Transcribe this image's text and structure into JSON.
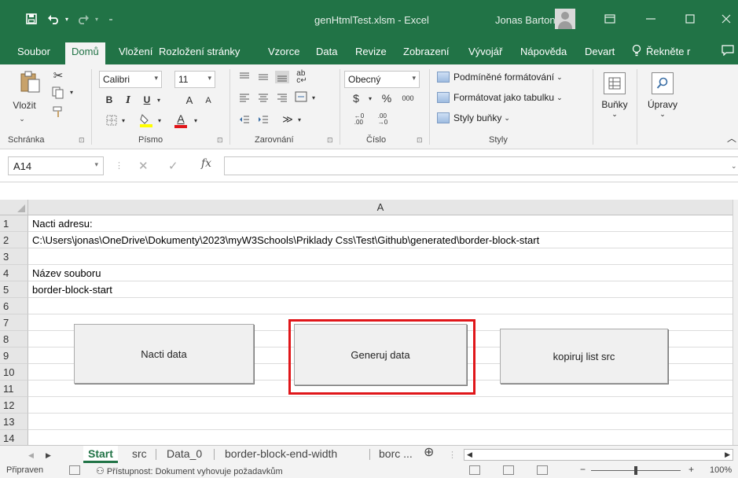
{
  "window": {
    "title": "genHtmlTest.xlsm  -  Excel",
    "user": "Jonas Barton"
  },
  "quick_access": {
    "save_icon": "save-icon",
    "undo_icon": "undo-icon",
    "redo_icon": "redo-icon"
  },
  "ribbon_tabs": [
    "Soubor",
    "Domů",
    "Vložení",
    "Rozložení stránky",
    "Vzorce",
    "Data",
    "Revize",
    "Zobrazení",
    "Vývojář",
    "Nápověda",
    "Devart",
    "Řekněte r"
  ],
  "ribbon_tabs_active": "Domů",
  "ribbon": {
    "clipboard": {
      "paste_label": "Vložit",
      "group_label": "Schránka"
    },
    "font": {
      "font_name": "Calibri",
      "font_size": "11",
      "bold": "B",
      "italic": "I",
      "underline": "U",
      "grow": "A",
      "shrink": "A",
      "font_color": "A",
      "group_label": "Písmo"
    },
    "alignment": {
      "group_label": "Zarovnání"
    },
    "number": {
      "format": "Obecný",
      "currency": "$",
      "percent": "%",
      "thousands": "000",
      "group_label": "Číslo"
    },
    "styles": {
      "conditional": "Podmíněné formátování",
      "as_table": "Formátovat jako tabulku",
      "cell_styles": "Styly buňky",
      "group_label": "Styly"
    },
    "cells": {
      "label": "Buňky"
    },
    "editing": {
      "label": "Úpravy"
    }
  },
  "formula_bar": {
    "name_box": "A14",
    "fx": "fx",
    "value": ""
  },
  "sheet": {
    "column_header": "A",
    "rows": [
      {
        "num": "1",
        "value": "Nacti adresu:"
      },
      {
        "num": "2",
        "value": "C:\\Users\\jonas\\OneDrive\\Dokumenty\\2023\\myW3Schools\\Priklady Css\\Test\\Github\\generated\\border-block-start"
      },
      {
        "num": "3",
        "value": ""
      },
      {
        "num": "4",
        "value": "Název souboru"
      },
      {
        "num": "5",
        "value": "border-block-start"
      },
      {
        "num": "6",
        "value": ""
      },
      {
        "num": "7",
        "value": ""
      },
      {
        "num": "8",
        "value": ""
      },
      {
        "num": "9",
        "value": ""
      },
      {
        "num": "10",
        "value": ""
      },
      {
        "num": "11",
        "value": ""
      },
      {
        "num": "12",
        "value": ""
      },
      {
        "num": "13",
        "value": ""
      },
      {
        "num": "14",
        "value": ""
      }
    ],
    "buttons": {
      "nacti": "Nacti data",
      "generuj": "Generuj data",
      "kopiruj": "kopiruj list src"
    }
  },
  "sheet_tabs": [
    "Start",
    "src",
    "Data_0",
    "border-block-end-width",
    "borc ..."
  ],
  "sheet_tabs_active": "Start",
  "status": {
    "mode": "Připraven",
    "accessibility": "Přístupnost: Dokument vyhovuje požadavkům",
    "zoom": "100%"
  },
  "colors": {
    "excel_green": "#217346",
    "highlight_red": "#e0161a"
  }
}
